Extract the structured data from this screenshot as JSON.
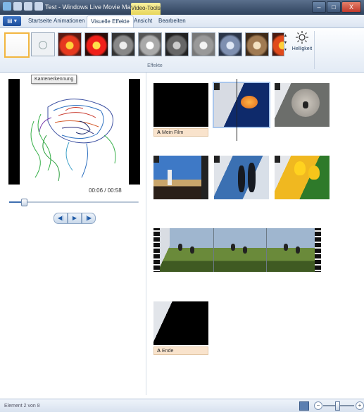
{
  "window": {
    "title": "Test - Windows Live Movie Maker",
    "contextual_tab_group": "Video-Tools",
    "controls": {
      "minimize": "–",
      "maximize": "□",
      "close": "X"
    }
  },
  "ribbon": {
    "tabs": [
      "Startseite",
      "Animationen",
      "Visuelle Effekte",
      "Ansicht",
      "Bearbeiten"
    ],
    "active_tab": "Visuelle Effekte",
    "effects_group_label": "Effekte",
    "brightness_label": "Helligkeit",
    "effects": [
      "none",
      "blur",
      "warm",
      "saturated",
      "grayscale",
      "grayscale-light",
      "grayscale-dark",
      "grayscale-soft",
      "cool",
      "sepia",
      "film-age"
    ],
    "selected_effect_index": 0
  },
  "tooltip": {
    "text": "Kantenerkennung"
  },
  "preview": {
    "time": "00:06 / 00:58",
    "seek_fraction": 0.11,
    "buttons": {
      "prev_frame": "◀|",
      "play": "▶",
      "next_frame": "|▶"
    }
  },
  "storyboard": {
    "captions": {
      "title_clip": "Mein Film",
      "end_clip": "Ende"
    },
    "caption_icon": "A"
  },
  "status": {
    "text": "Element 2 von 8",
    "zoom_minus": "−",
    "zoom_plus": "+",
    "zoom_level": 0.45
  },
  "colors": {
    "selection_border": "#f2b640",
    "caption_bg": "#f9e3cc",
    "titlebar": "#2f425c"
  }
}
